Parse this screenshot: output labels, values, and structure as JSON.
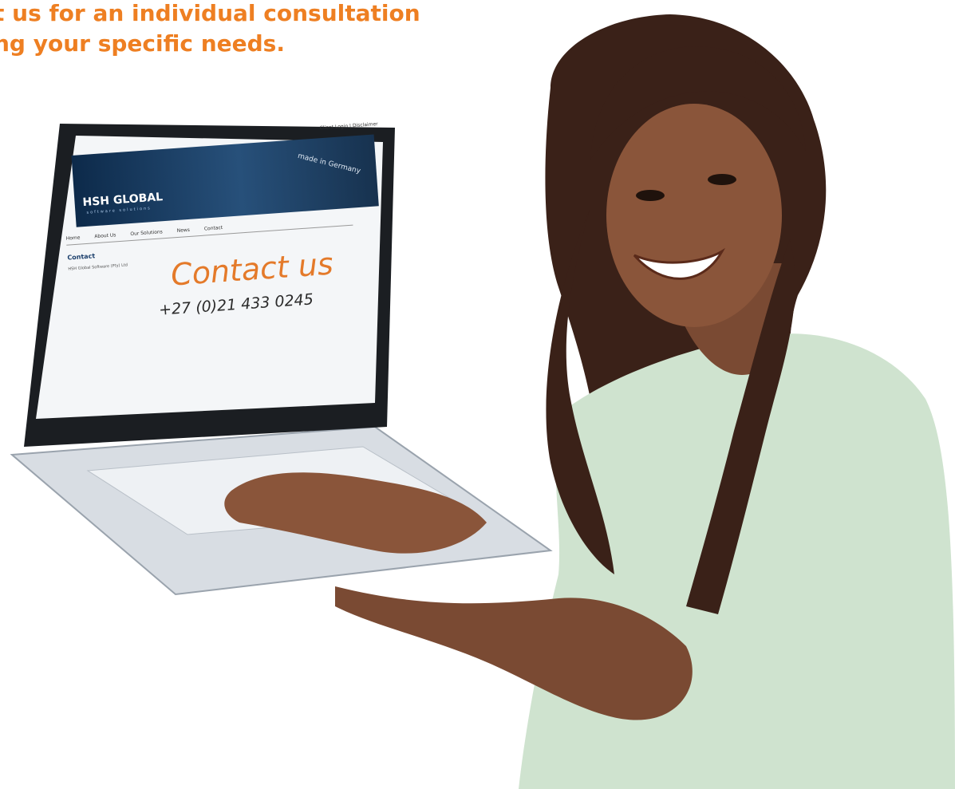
{
  "headline": {
    "line1": "t us for an individual consultation",
    "line2": "ng your specific needs."
  },
  "screen": {
    "topbar": "Client Login | Disclaimer",
    "logo": "HSH GLOBAL",
    "logo_sub": "software solutions",
    "tagline": "made in Germany",
    "nav": [
      "Home",
      "About Us",
      "Our Solutions",
      "News",
      "Contact"
    ],
    "sidebar_title": "Contact",
    "sidebar_text": "HSH Global Software (Pty) Ltd",
    "heading": "Contact us",
    "phone": "+27 (0)21 433 0245"
  },
  "colors": {
    "accent": "#ee7f22",
    "skin": "#7a4a33",
    "shirt": "#cfe3cf",
    "hair": "#3a2118",
    "laptop_body": "#d8dde3",
    "laptop_bezel": "#1b1e22"
  }
}
